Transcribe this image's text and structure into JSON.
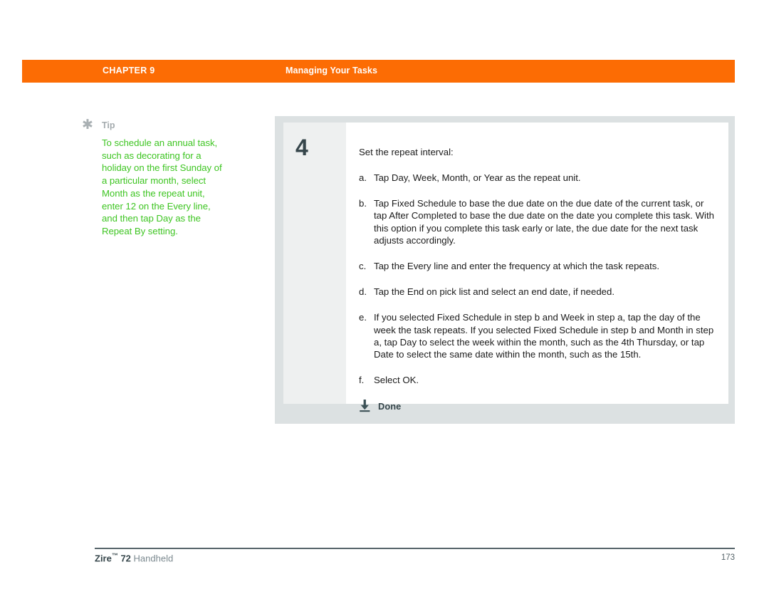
{
  "header": {
    "chapter_label": "CHAPTER 9",
    "section_title": "Managing Your Tasks",
    "bar_color": "#fc6c04"
  },
  "tip": {
    "icon": "asterisk-icon",
    "label": "Tip",
    "text": "To schedule an annual task, such as decorating for a holiday on the first Sunday of a particular month, select Month as the repeat unit, enter 12 on the Every line, and then tap Day as the Repeat By setting.",
    "text_color": "#3ec522",
    "label_color": "#a4abae"
  },
  "step": {
    "number": "4",
    "intro": "Set the repeat interval:",
    "substeps": [
      {
        "marker": "a.",
        "text": "Tap Day, Week, Month, or Year as the repeat unit."
      },
      {
        "marker": "b.",
        "text": "Tap Fixed Schedule to base the due date on the due date of the current task, or tap After Completed to base the due date on the date you complete this task. With this option if you complete this task early or late, the due date for the next task adjusts accordingly."
      },
      {
        "marker": "c.",
        "text": "Tap the Every line and enter the frequency at which the task repeats."
      },
      {
        "marker": "d.",
        "text": "Tap the End on pick list and select an end date, if needed."
      },
      {
        "marker": "e.",
        "text": "If you selected Fixed Schedule in step b and Week in step a, tap the day of the week the task repeats. If you selected Fixed Schedule in step b and Month in step a, tap Day to select the week within the month, such as the 4th Thursday, or tap Date to select the same date within the month, such as the 15th."
      },
      {
        "marker": "f.",
        "text": "Select OK."
      }
    ],
    "done": {
      "icon": "download-arrow-icon",
      "label": "Done",
      "color": "#36464b"
    }
  },
  "footer": {
    "brand": "Zire",
    "trademark": "™",
    "model": " 72",
    "product": " Handheld",
    "page_number": "173"
  }
}
